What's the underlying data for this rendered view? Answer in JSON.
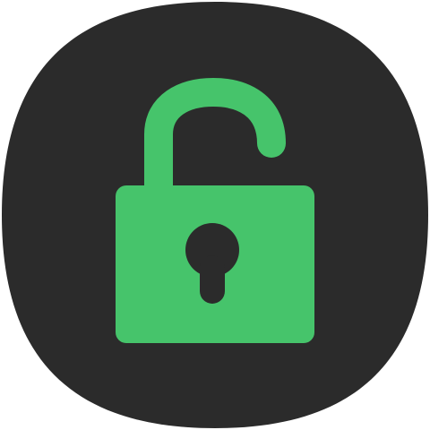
{
  "icon": {
    "name": "unlocked-padlock",
    "colors": {
      "background": "#2b2b2b",
      "lock": "#46c46b",
      "keyhole": "#2b2b2b",
      "page": "#ffffff"
    }
  }
}
